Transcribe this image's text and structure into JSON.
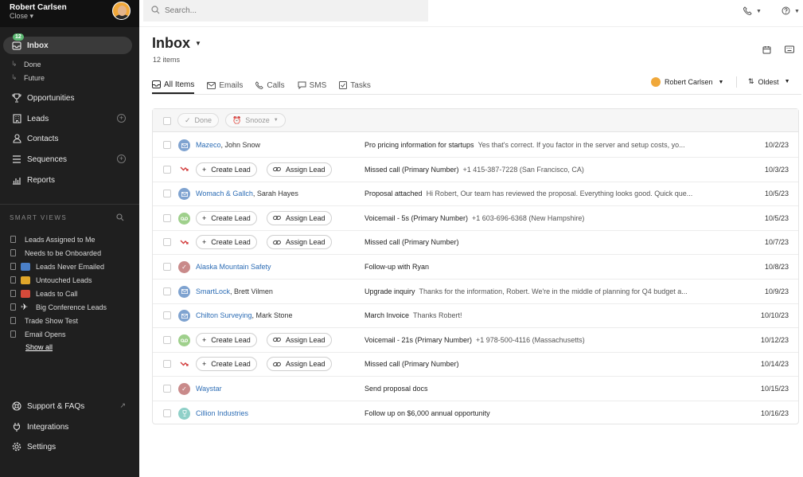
{
  "user": {
    "name": "Robert Carlsen",
    "org": "Close"
  },
  "search": {
    "placeholder": "Search..."
  },
  "nav": {
    "inbox": {
      "label": "Inbox",
      "badge": "12"
    },
    "done": "Done",
    "future": "Future",
    "opportunities": "Opportunities",
    "leads": "Leads",
    "contacts": "Contacts",
    "sequences": "Sequences",
    "reports": "Reports"
  },
  "smart_views": {
    "header": "SMART VIEWS",
    "items": [
      "Leads Assigned to Me",
      "Needs to be Onboarded",
      "Leads Never Emailed",
      "Untouched Leads",
      "Leads to Call",
      "Big Conference Leads",
      "Trade Show Test",
      "Email Opens"
    ],
    "show_all": "Show all"
  },
  "footer_nav": {
    "support": "Support & FAQs",
    "integrations": "Integrations",
    "settings": "Settings"
  },
  "main": {
    "title": "Inbox",
    "count": "12 items",
    "tabs": [
      "All Items",
      "Emails",
      "Calls",
      "SMS",
      "Tasks"
    ],
    "owner": "Robert Carlsen",
    "sort": "Oldest",
    "toolbar": {
      "done": "Done",
      "snooze": "Snooze"
    },
    "create_lead": "Create Lead",
    "assign_lead": "Assign Lead",
    "rows": [
      {
        "type": "email",
        "company": "Mazeco",
        "contact": ", John Snow",
        "subject": "Pro pricing information for startups",
        "preview": "Yes that's correct. If you factor in the server and setup costs, yo...",
        "date": "10/2/23"
      },
      {
        "type": "missed",
        "subject": "Missed call (Primary Number)",
        "preview": "+1 415-387-7228 (San Francisco, CA)",
        "date": "10/3/23"
      },
      {
        "type": "email",
        "company": "Womach & Gallch",
        "contact": ", Sarah Hayes",
        "subject": "Proposal attached",
        "preview": "Hi Robert, Our team has reviewed the proposal. Everything looks good. Quick que...",
        "date": "10/5/23"
      },
      {
        "type": "voicemail",
        "subject": "Voicemail - 5s (Primary Number)",
        "preview": "+1 603-696-6368 (New Hampshire)",
        "date": "10/5/23"
      },
      {
        "type": "missed",
        "subject": "Missed call (Primary Number)",
        "preview": "",
        "date": "10/7/23"
      },
      {
        "type": "task",
        "company": "Alaska Mountain Safety",
        "contact": "",
        "subject": "Follow-up with Ryan",
        "preview": "",
        "date": "10/8/23"
      },
      {
        "type": "email",
        "company": "SmartLock",
        "contact": ", Brett Vilmen",
        "subject": "Upgrade inquiry",
        "preview": "Thanks for the information, Robert. We're in the middle of planning for Q4 budget a...",
        "date": "10/9/23"
      },
      {
        "type": "email",
        "company": "Chilton Surveying",
        "contact": ", Mark Stone",
        "subject": "March Invoice",
        "preview": "Thanks Robert!",
        "date": "10/10/23"
      },
      {
        "type": "voicemail",
        "subject": "Voicemail - 21s (Primary Number)",
        "preview": "+1 978-500-4116 (Massachusetts)",
        "date": "10/12/23"
      },
      {
        "type": "missed",
        "subject": "Missed call (Primary Number)",
        "preview": "",
        "date": "10/14/23"
      },
      {
        "type": "task",
        "company": "Waystar",
        "contact": "",
        "subject": "Send proposal docs",
        "preview": "",
        "date": "10/15/23"
      },
      {
        "type": "opportunity",
        "company": "Cillion Industries",
        "contact": "",
        "subject": "Follow up on $6,000 annual opportunity",
        "preview": "",
        "date": "10/16/23"
      }
    ]
  },
  "colors": {
    "email": "#7fa3d0",
    "voicemail": "#9fd08c",
    "task": "#c98a8a",
    "opportunity": "#8fd0c8",
    "missed": "#d23b3b",
    "link": "#2d6db5"
  }
}
